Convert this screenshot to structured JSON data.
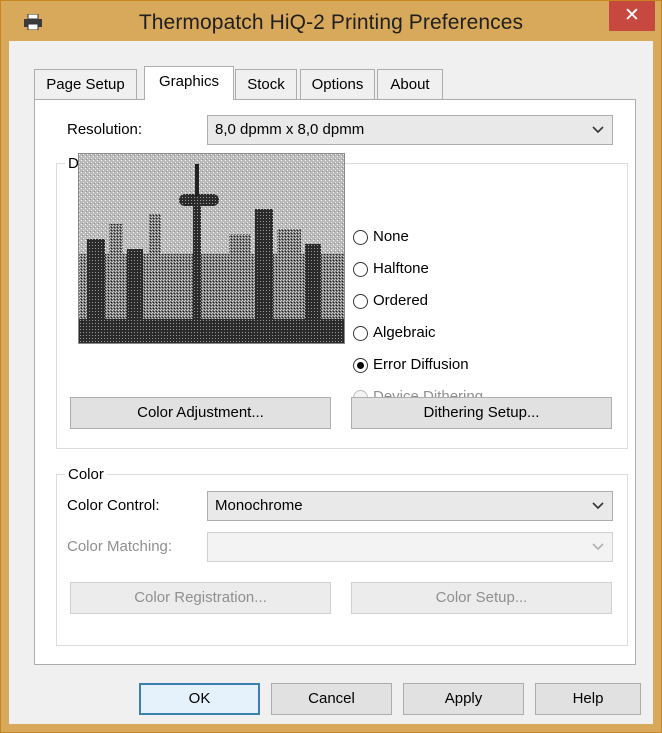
{
  "window": {
    "title": "Thermopatch HiQ-2 Printing Preferences",
    "close_glyph": "✕",
    "accent_color": "#d9a95b"
  },
  "tabs": [
    {
      "label": "Page Setup",
      "active": false
    },
    {
      "label": "Graphics",
      "active": true
    },
    {
      "label": "Stock",
      "active": false
    },
    {
      "label": "Options",
      "active": false
    },
    {
      "label": "About",
      "active": false
    }
  ],
  "resolution": {
    "label": "Resolution:",
    "value": "8,0 dpmm x 8,0 dpmm"
  },
  "dithering": {
    "group_title": "Dithering",
    "preview_icon": "city-skyline-image",
    "options": [
      {
        "label": "None",
        "selected": false,
        "enabled": true
      },
      {
        "label": "Halftone",
        "selected": false,
        "enabled": true
      },
      {
        "label": "Ordered",
        "selected": false,
        "enabled": true
      },
      {
        "label": "Algebraic",
        "selected": false,
        "enabled": true
      },
      {
        "label": "Error Diffusion",
        "selected": true,
        "enabled": true
      },
      {
        "label": "Device Dithering",
        "selected": false,
        "enabled": false
      }
    ],
    "color_adjustment_button": "Color Adjustment...",
    "dithering_setup_button": "Dithering Setup..."
  },
  "color": {
    "group_title": "Color",
    "color_control_label": "Color Control:",
    "color_control_value": "Monochrome",
    "color_matching_label": "Color Matching:",
    "color_matching_value": "",
    "color_registration_button": "Color Registration...",
    "color_setup_button": "Color Setup..."
  },
  "footer": {
    "ok": "OK",
    "cancel": "Cancel",
    "apply": "Apply",
    "help": "Help"
  }
}
